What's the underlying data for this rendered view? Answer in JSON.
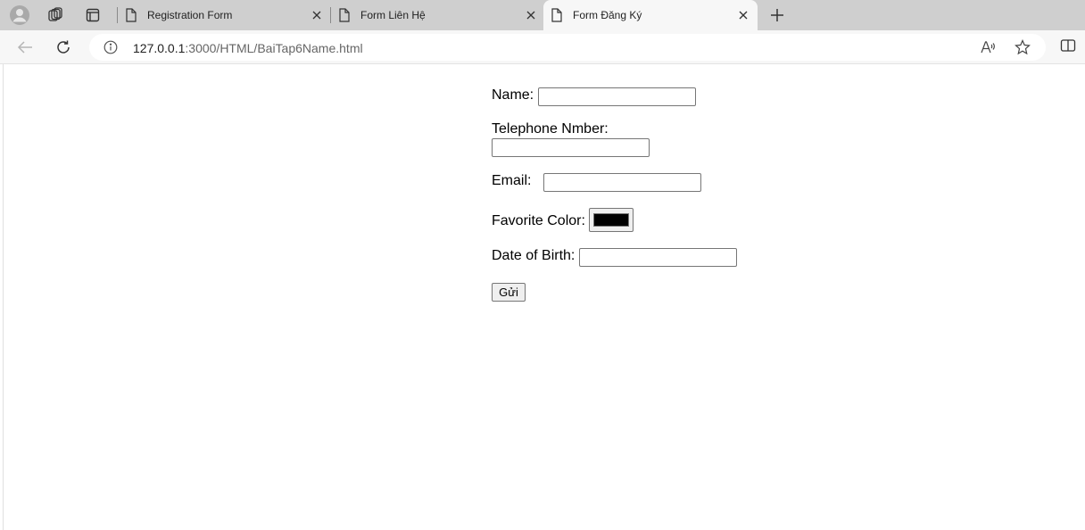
{
  "browser": {
    "tabs": [
      {
        "title": "Registration Form",
        "active": false
      },
      {
        "title": "Form Liên Hệ",
        "active": false
      },
      {
        "title": "Form Đăng Ký",
        "active": true
      }
    ],
    "url_host": "127.0.0.1",
    "url_rest": ":3000/HTML/BaiTap6Name.html"
  },
  "form": {
    "name_label": "Name:",
    "name_value": "",
    "phone_label": "Telephone Nmber:",
    "phone_value": "",
    "email_label": "Email:",
    "email_value": "",
    "color_label": "Favorite Color:",
    "color_value": "#000000",
    "dob_label": "Date of Birth:",
    "dob_value": "",
    "submit_label": "Gửi"
  },
  "icons": {
    "profile": "profile-icon",
    "workspaces": "workspaces-icon",
    "tab_actions": "tab-actions-icon",
    "page": "page-icon",
    "close": "close-icon",
    "new_tab": "plus-icon",
    "back": "back-arrow-icon",
    "refresh": "refresh-icon",
    "info": "info-icon",
    "read_aloud": "read-aloud-icon",
    "favorite": "star-icon",
    "split": "split-screen-icon"
  }
}
